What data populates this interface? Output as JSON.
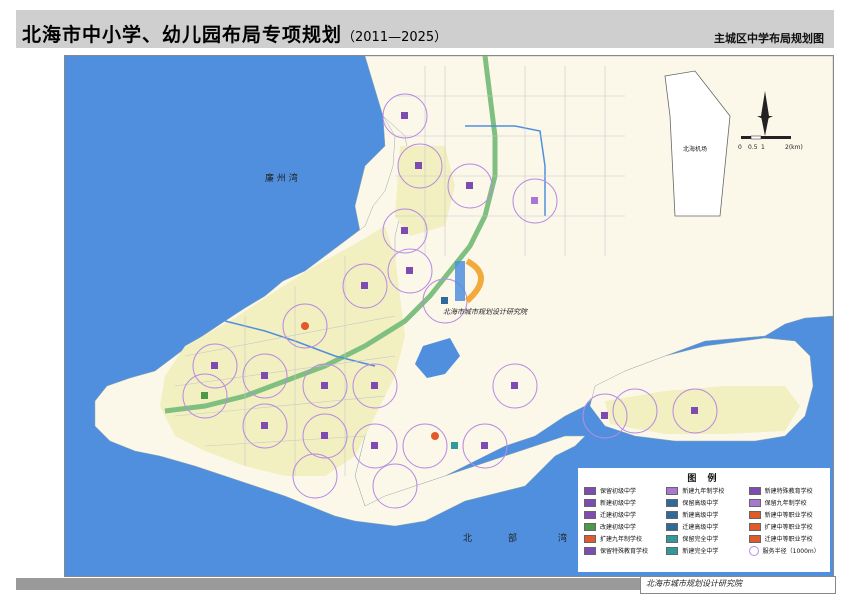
{
  "header": {
    "title": "北海市中小学、幼儿园布局专项规划",
    "years": "（2011—2025）",
    "subtitle": "主城区中学布局规划图"
  },
  "map": {
    "water_labels": {
      "bay_west": "廉 州 湾",
      "bay_south_1": "北",
      "bay_south_2": "部",
      "bay_south_3": "湾"
    },
    "airport_label": "北海机场",
    "scale": {
      "ticks": [
        "0",
        "0.5",
        "1",
        "2(km)"
      ]
    },
    "watermark": "北海市城市规划设计研究院",
    "colors": {
      "sea": "#4f8fde",
      "land": "#fbf8ea",
      "urban": "#f2efc0",
      "road_green": "#7fbf7f",
      "circle": "#b98be3",
      "school": "#7e4bb3",
      "river": "#4f8fde"
    }
  },
  "legend": {
    "title": "图 例",
    "items": [
      {
        "label": "保留初级中学",
        "color": "#7e4bb3",
        "symbol": ""
      },
      {
        "label": "新建九年制学校",
        "color": "#a877d1",
        "symbol": ""
      },
      {
        "label": "新建特殊教育学校",
        "color": "#7e4bb3",
        "symbol": ""
      },
      {
        "label": "新建初级中学",
        "color": "#7e4bb3",
        "symbol": ""
      },
      {
        "label": "保留高级中学",
        "color": "#2f6a9a",
        "symbol": ""
      },
      {
        "label": "保留九年制学校",
        "color": "#a877d1",
        "symbol": ""
      },
      {
        "label": "迁建初级中学",
        "color": "#7e4bb3",
        "symbol": ""
      },
      {
        "label": "新建高级中学",
        "color": "#2f6a9a",
        "symbol": ""
      },
      {
        "label": "新建中等职业学校",
        "color": "#e05a2a",
        "symbol": ""
      },
      {
        "label": "改建初级中学",
        "color": "#4a9a4a",
        "symbol": ""
      },
      {
        "label": "迁建高级中学",
        "color": "#2f6a9a",
        "symbol": ""
      },
      {
        "label": "扩建中等职业学校",
        "color": "#e05a2a",
        "symbol": ""
      },
      {
        "label": "扩建九年制学校",
        "color": "#e05a2a",
        "symbol": ""
      },
      {
        "label": "保留完全中学",
        "color": "#2f9a9a",
        "symbol": ""
      },
      {
        "label": "迁建中等职业学校",
        "color": "#e05a2a",
        "symbol": ""
      },
      {
        "label": "保留特殊教育学校",
        "color": "#7e4bb3",
        "symbol": ""
      },
      {
        "label": "新建完全中学",
        "color": "#2f9a9a",
        "symbol": ""
      },
      {
        "label": "服务半径（1000m）",
        "color": "#b98be3",
        "symbol": "circle"
      }
    ]
  },
  "footer": {
    "logo": "北海市城市规划设计研究院"
  }
}
